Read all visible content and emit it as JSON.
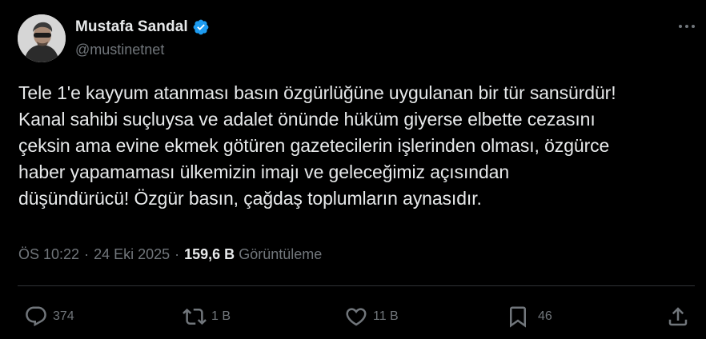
{
  "author": {
    "display_name": "Mustafa Sandal",
    "handle": "@mustinetnet",
    "verified": true
  },
  "tweet": {
    "text": "Tele 1'e kayyum atanması basın özgürlüğüne uygulanan bir tür sansürdür!\nKanal sahibi suçluysa ve adalet önünde hüküm giyerse elbette cezasını\nçeksin ama evine ekmek götüren gazetecilerin işlerinden olması, özgürce\nhaber yapamaması ülkemizin imajı ve geleceğimiz açısından\ndüşündürücü! Özgür basın, çağdaş toplumların aynasıdır.",
    "time": "ÖS 10:22",
    "date": "24 Eki 2025",
    "views_count": "159,6 B",
    "views_label": "Görüntüleme",
    "separator": "·"
  },
  "actions": {
    "replies": "374",
    "reposts": "1 B",
    "likes": "11 B",
    "bookmarks": "46"
  },
  "icons": {
    "verified": "verified-badge-icon",
    "more": "more-icon",
    "reply": "reply-icon",
    "repost": "repost-icon",
    "like": "heart-icon",
    "bookmark": "bookmark-icon",
    "share": "share-icon"
  },
  "colors": {
    "background": "#000000",
    "text_primary": "#e7e9ea",
    "text_secondary": "#71767b",
    "divider": "#2f3336",
    "verified_blue": "#1d9bf0"
  }
}
